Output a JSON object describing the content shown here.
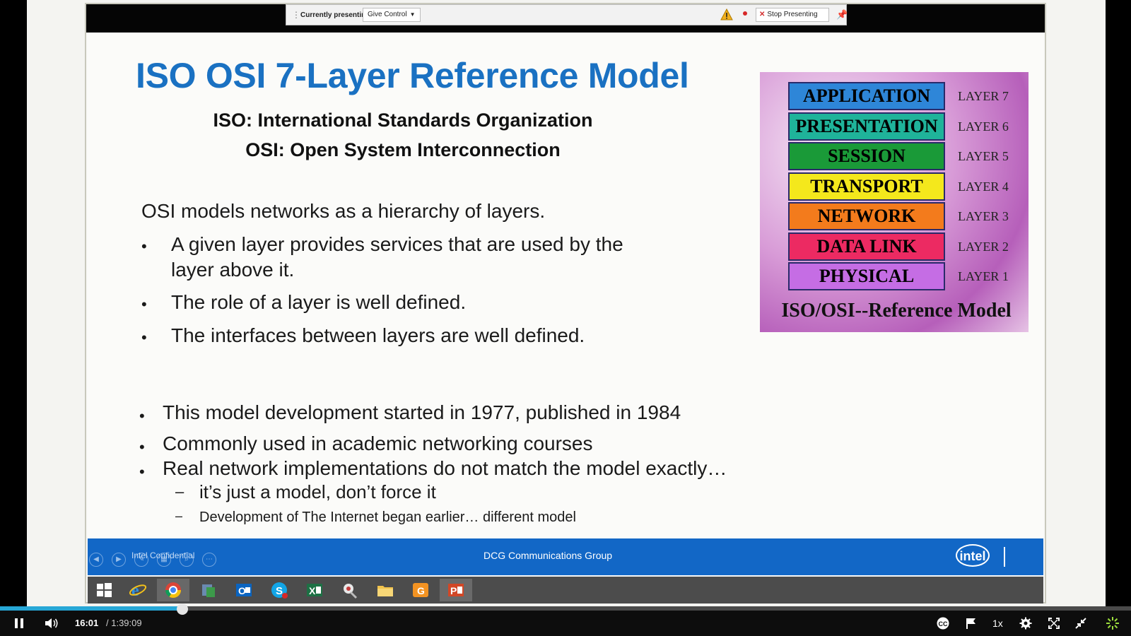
{
  "presenting_bar": {
    "status_label": "Currently presenting",
    "give_control_label": "Give Control",
    "stop_label": "Stop Presenting"
  },
  "slide": {
    "title": "ISO OSI 7-Layer Reference Model",
    "subtitle_iso": "ISO: International Standards Organization",
    "subtitle_osi": "OSI:  Open System Interconnection",
    "intro": "OSI models networks as a hierarchy of layers.",
    "bullets_top": [
      "A given layer provides services that are used by the",
      "layer above it.",
      "The role of a layer is well defined.",
      "The interfaces between layers are well defined."
    ],
    "bullets_bottom": [
      "This model development started in 1977, published in 1984",
      "Commonly used in academic networking courses",
      "Real network implementations do not match the model exactly…"
    ],
    "sub_bullets": [
      "it’s just a model, don’t force it",
      "Development of The Internet began earlier… different model"
    ],
    "osi_diagram": {
      "layers": [
        {
          "name": "APPLICATION",
          "label": "LAYER 7",
          "color": "#2e86d8"
        },
        {
          "name": "PRESENTATION",
          "label": "LAYER 6",
          "color": "#1fb39a"
        },
        {
          "name": "SESSION",
          "label": "LAYER 5",
          "color": "#1a9a38"
        },
        {
          "name": "TRANSPORT",
          "label": "LAYER 4",
          "color": "#f4e81c"
        },
        {
          "name": "NETWORK",
          "label": "LAYER 3",
          "color": "#f37b1c"
        },
        {
          "name": "DATA LINK",
          "label": "LAYER 2",
          "color": "#ec2a62"
        },
        {
          "name": "PHYSICAL",
          "label": "LAYER 1",
          "color": "#c56de4"
        }
      ],
      "caption": "ISO/OSI--Reference Model"
    },
    "footer": {
      "confidential": "Intel Confidential",
      "group": "DCG Communications Group",
      "logo": "intel"
    }
  },
  "taskbar": {
    "items": [
      "windows-start",
      "internet-explorer",
      "chrome",
      "file-manager",
      "outlook",
      "skype",
      "excel",
      "snipping-tool",
      "file-explorer",
      "calendar",
      "powerpoint"
    ]
  },
  "player": {
    "current_time": "16:01",
    "duration": "/ 1:39:09",
    "progress_fraction": 0.161,
    "speed": "1x",
    "accent_color": "#27a7d6"
  }
}
